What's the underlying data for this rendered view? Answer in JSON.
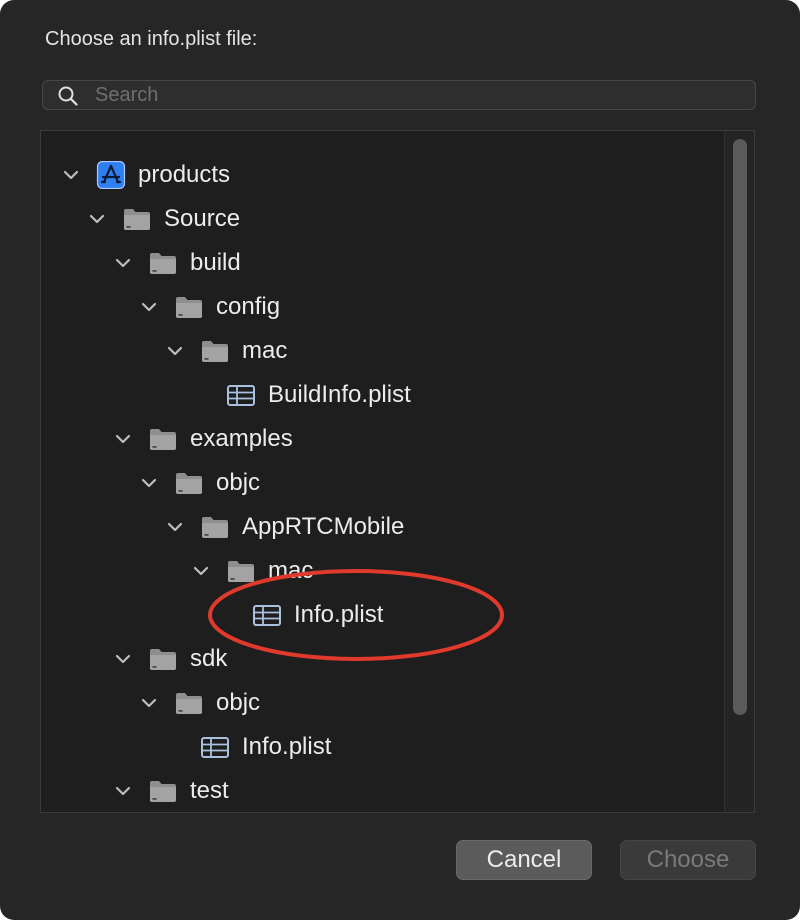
{
  "dialog": {
    "prompt": "Choose an info.plist file:",
    "search": {
      "placeholder": "Search",
      "value": ""
    },
    "buttons": {
      "cancel": "Cancel",
      "choose": "Choose"
    }
  },
  "tree": {
    "rows": [
      {
        "label": "products",
        "kind": "project",
        "depth": 0,
        "expanded": true
      },
      {
        "label": "Source",
        "kind": "folder",
        "depth": 1,
        "expanded": true
      },
      {
        "label": "build",
        "kind": "folder",
        "depth": 2,
        "expanded": true
      },
      {
        "label": "config",
        "kind": "folder",
        "depth": 3,
        "expanded": true
      },
      {
        "label": "mac",
        "kind": "folder",
        "depth": 4,
        "expanded": true
      },
      {
        "label": "BuildInfo.plist",
        "kind": "plist",
        "depth": 5
      },
      {
        "label": "examples",
        "kind": "folder",
        "depth": 2,
        "expanded": true
      },
      {
        "label": "objc",
        "kind": "folder",
        "depth": 3,
        "expanded": true
      },
      {
        "label": "AppRTCMobile",
        "kind": "folder",
        "depth": 4,
        "expanded": true
      },
      {
        "label": "mac",
        "kind": "folder",
        "depth": 5,
        "expanded": true
      },
      {
        "label": "Info.plist",
        "kind": "plist",
        "depth": 6,
        "highlighted": true
      },
      {
        "label": "sdk",
        "kind": "folder",
        "depth": 2,
        "expanded": true
      },
      {
        "label": "objc",
        "kind": "folder",
        "depth": 3,
        "expanded": true
      },
      {
        "label": "Info.plist",
        "kind": "plist",
        "depth": 4
      },
      {
        "label": "test",
        "kind": "folder",
        "depth": 2,
        "expanded": true
      }
    ]
  },
  "icons": {
    "search": "magnifying-glass-icon",
    "chevron": "chevron-down-icon",
    "project": "xcode-project-icon",
    "folder": "folder-icon",
    "plist": "property-list-icon"
  },
  "colors": {
    "dialog_bg": "#262626",
    "tree_bg": "#1e1e1e",
    "project_icon": "#2f7ff0",
    "plist_icon": "#a9c1dc",
    "annotation": "#e03a2c"
  }
}
